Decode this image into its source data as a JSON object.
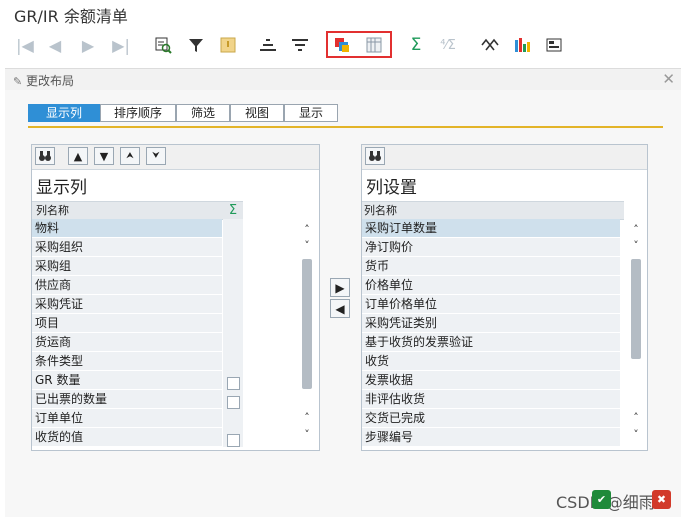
{
  "window": {
    "title": "GR/IR 余额清单"
  },
  "toolbar": {
    "icons": [
      "first-page-icon",
      "previous-page-icon",
      "next-page-icon",
      "last-page-icon",
      "find-icon",
      "filter-icon",
      "export-icon",
      "sort-ascending-icon",
      "sort-descending-icon",
      "change-layout-icon",
      "select-layout-icon",
      "sum-icon",
      "subtotal-icon",
      "view-switch-icon",
      "chart-icon",
      "layout-grid-icon"
    ]
  },
  "dialog": {
    "title": "更改布局",
    "tabs": [
      "显示列",
      "排序顺序",
      "筛选",
      "视图",
      "显示"
    ],
    "left": {
      "title": "显示列",
      "col_header": "列名称",
      "sum_header": "Σ",
      "rows": [
        "物料",
        "采购组织",
        "采购组",
        "供应商",
        "采购凭证",
        "项目",
        "货运商",
        "条件类型",
        "GR 数量",
        "已出票的数量",
        "订单单位",
        "收货的值"
      ]
    },
    "right": {
      "title": "列设置",
      "col_header": "列名称",
      "rows": [
        "采购订单数量",
        "净订购价",
        "货币",
        "价格单位",
        "订单价格单位",
        "采购凭证类别",
        "基于收货的发票验证",
        "收货",
        "发票收据",
        "非评估收货",
        "交货已完成",
        "步骤编号"
      ]
    }
  },
  "footer": {
    "watermark": "CSDN @细雨"
  }
}
